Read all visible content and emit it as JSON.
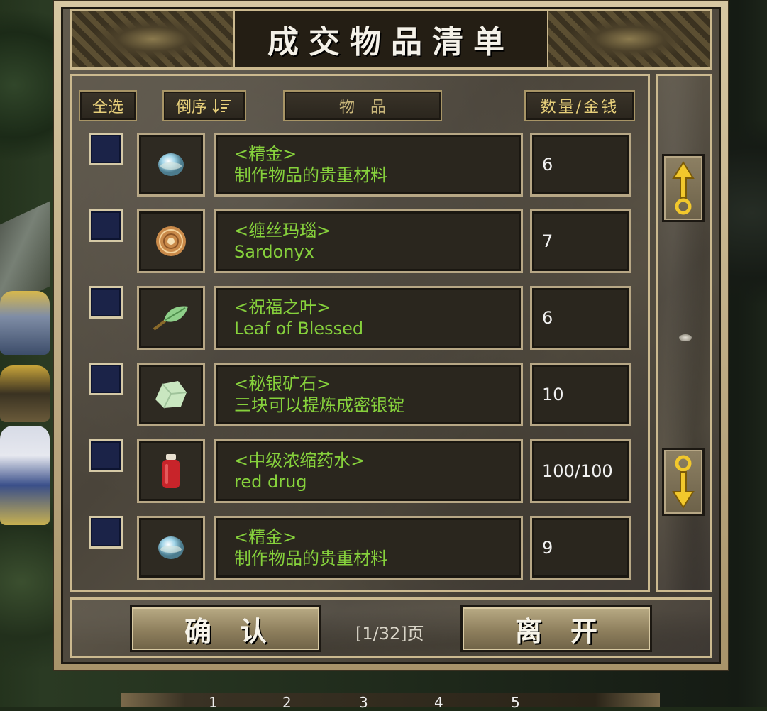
{
  "window": {
    "title": "成交物品清单",
    "colors": {
      "item_text": "#86d13c",
      "header_text": "#e7cf7a",
      "checkbox": "#1b2348"
    }
  },
  "header": {
    "select_all": "全选",
    "reverse": "倒序",
    "reverse_icon": "sort-descending-icon",
    "item_col": "物　品",
    "qty_col": "数量/金钱"
  },
  "items": [
    {
      "icon": "refined-gold-orb-icon",
      "name": "<精金>",
      "desc": "制作物品的贵重材料",
      "qty": "6"
    },
    {
      "icon": "sardonyx-stone-icon",
      "name": "<缠丝玛瑙>",
      "desc": "Sardonyx",
      "qty": "7"
    },
    {
      "icon": "leaf-icon",
      "name": "<祝福之叶>",
      "desc": "Leaf of Blessed",
      "qty": "6"
    },
    {
      "icon": "mithril-ore-icon",
      "name": "<秘银矿石>",
      "desc": "三块可以提炼成密银锭",
      "qty": "10"
    },
    {
      "icon": "red-potion-icon",
      "name": "<中级浓缩药水>",
      "desc": "red drug",
      "qty": "100/100"
    },
    {
      "icon": "refined-gold-orb-icon",
      "name": "<精金>",
      "desc": "制作物品的贵重材料",
      "qty": "9"
    }
  ],
  "footer": {
    "confirm": "确认",
    "page": "[1/32]页",
    "leave": "离开"
  },
  "hotbar": {
    "slots": [
      "1",
      "2",
      "3",
      "4",
      "5"
    ]
  }
}
